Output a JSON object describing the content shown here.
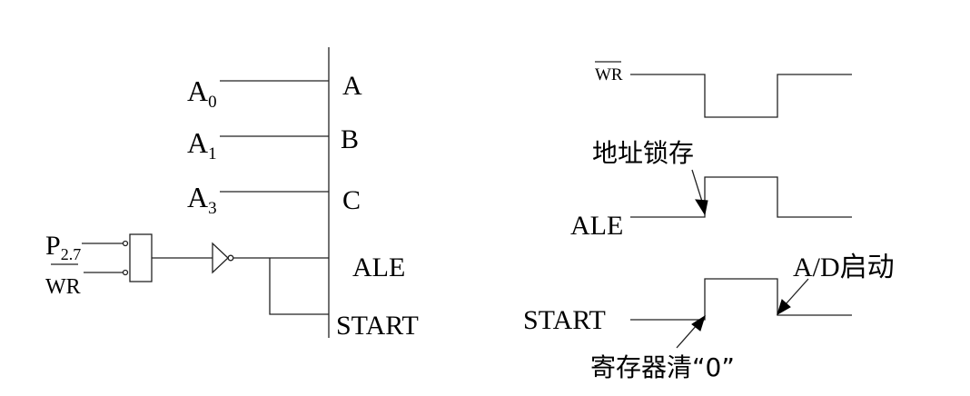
{
  "circuit": {
    "inputs": {
      "a0": {
        "main": "A",
        "sub": "0"
      },
      "a1": {
        "main": "A",
        "sub": "1"
      },
      "a3": {
        "main": "A",
        "sub": "3"
      },
      "p27": {
        "main": "P",
        "sub": "2.7"
      },
      "wr": "WR"
    },
    "chip_pins": {
      "a": "A",
      "b": "B",
      "c": "C",
      "ale": "ALE",
      "start": "START"
    }
  },
  "timing": {
    "signals": {
      "wr": "WR",
      "ale": "ALE",
      "start": "START"
    },
    "annotations": {
      "address_latch": "地址锁存",
      "ad_start": "A/D启动",
      "register_clear": "寄存器清“0”"
    }
  }
}
